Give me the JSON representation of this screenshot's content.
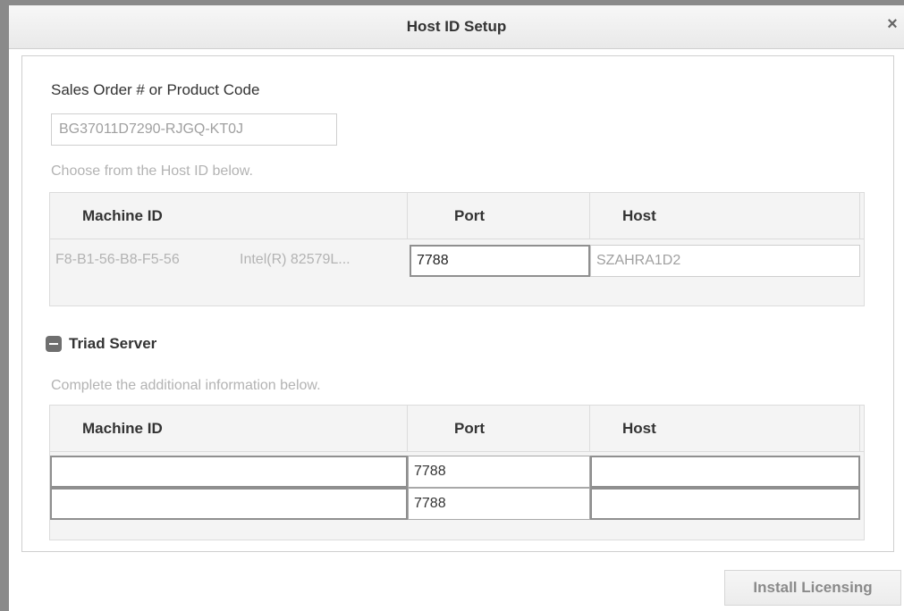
{
  "dialog": {
    "title": "Host ID Setup",
    "close_glyph": "×"
  },
  "sales": {
    "label": "Sales Order # or Product Code",
    "value": "BG37011D7290-RJGQ-KT0J"
  },
  "host_section": {
    "hint": "Choose from the Host ID below.",
    "columns": [
      "Machine ID",
      "Port",
      "Host"
    ],
    "rows": [
      {
        "machine_id": "F8-B1-56-B8-F5-56",
        "adapter": "Intel(R) 82579L...",
        "port": "7788",
        "host": "SZAHRA1D2"
      }
    ]
  },
  "triad": {
    "label": "Triad Server",
    "hint": "Complete the additional information below.",
    "columns": [
      "Machine ID",
      "Port",
      "Host"
    ],
    "rows": [
      {
        "machine_id": "",
        "port": "7788",
        "host": ""
      },
      {
        "machine_id": "",
        "port": "7788",
        "host": ""
      }
    ]
  },
  "footer": {
    "install_label": "Install Licensing"
  },
  "colors": {
    "title_bar": "#efefef",
    "border": "#cfcfcf",
    "hint_text": "#b3b3b3",
    "button_text": "#8a8a8a"
  }
}
